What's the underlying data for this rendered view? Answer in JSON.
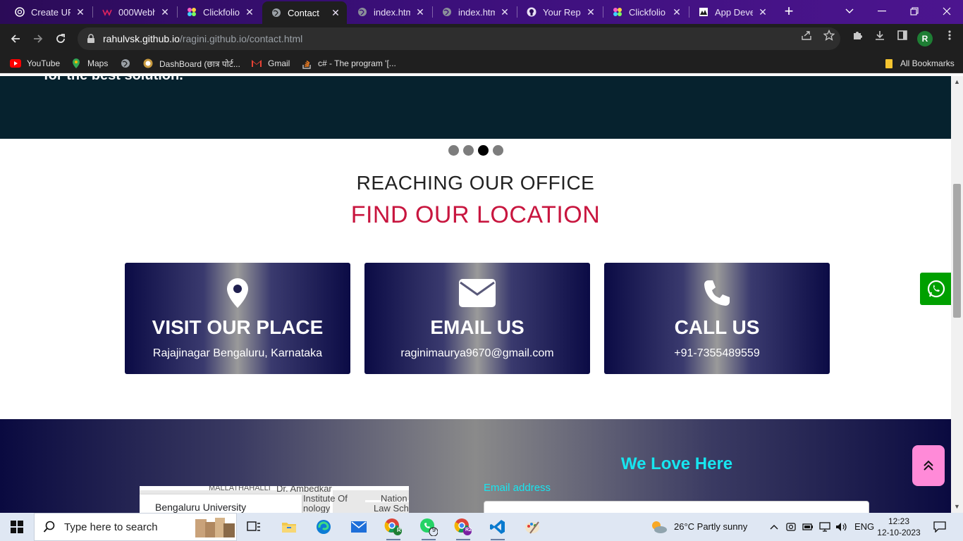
{
  "browser": {
    "tabs": [
      {
        "title": "Create UP",
        "icon": "chatgpt-icon",
        "active": false
      },
      {
        "title": "000Webho",
        "icon": "webhost-icon",
        "active": false
      },
      {
        "title": "Clickfolio",
        "icon": "clickfolio-icon",
        "active": false
      },
      {
        "title": "Contact",
        "icon": "globe-icon",
        "active": true
      },
      {
        "title": "index.htm",
        "icon": "globe-icon",
        "active": false
      },
      {
        "title": "index.htm",
        "icon": "globe-icon",
        "active": false
      },
      {
        "title": "Your Repo",
        "icon": "github-icon",
        "active": false
      },
      {
        "title": "Clickfolio",
        "icon": "clickfolio-icon",
        "active": false
      },
      {
        "title": "App Deve",
        "icon": "app-icon",
        "active": false
      }
    ],
    "url_host": "rahulvsk.github.io",
    "url_path": "/ragini.github.io/contact.html",
    "profile_initial": "R",
    "bookmarks": [
      {
        "label": "YouTube",
        "icon": "youtube-icon"
      },
      {
        "label": "Maps",
        "icon": "maps-icon"
      },
      {
        "label": "",
        "icon": "globe-icon"
      },
      {
        "label": "DashBoard (छात्र पोर्ट...",
        "icon": "dashboard-icon"
      },
      {
        "label": "Gmail",
        "icon": "gmail-icon"
      },
      {
        "label": "c# - The program '[...",
        "icon": "stackoverflow-icon"
      }
    ],
    "all_bookmarks_label": "All Bookmarks"
  },
  "page": {
    "hero_cut_text": "for the best solution.",
    "carousel": {
      "count": 4,
      "active_index": 2
    },
    "heading_sub": "REACHING OUR OFFICE",
    "heading_main": "FIND OUR LOCATION",
    "cards": [
      {
        "icon": "location-pin-icon",
        "title": "VISIT OUR PLACE",
        "text": "Rajajinagar Bengaluru, Karnataka"
      },
      {
        "icon": "envelope-icon",
        "title": "EMAIL US",
        "text": "raginimaurya9670@gmail.com"
      },
      {
        "icon": "phone-icon",
        "title": "CALL US",
        "text": "+91-7355489559"
      }
    ],
    "footer": {
      "title": "We Love Here",
      "email_label": "Email address",
      "map_place": "Bengaluru University",
      "map_labels": [
        "MALLATHAHALLI",
        "Dr. Ambedkar",
        "Institute Of",
        "nology",
        "Nation",
        "Law Sch"
      ]
    }
  },
  "taskbar": {
    "search_placeholder": "Type here to search",
    "weather": "26°C  Partly sunny",
    "language": "ENG",
    "time": "12:23",
    "date": "12-10-2023",
    "whatsapp_badge": "9",
    "chrome_profile_r": "R",
    "chrome_profile_r2": "R2"
  },
  "colors": {
    "accent_red": "#c8163f",
    "cyan": "#17e6f0",
    "whatsapp_green": "#00a000",
    "scroll_top_pink": "#ff8ad8"
  }
}
